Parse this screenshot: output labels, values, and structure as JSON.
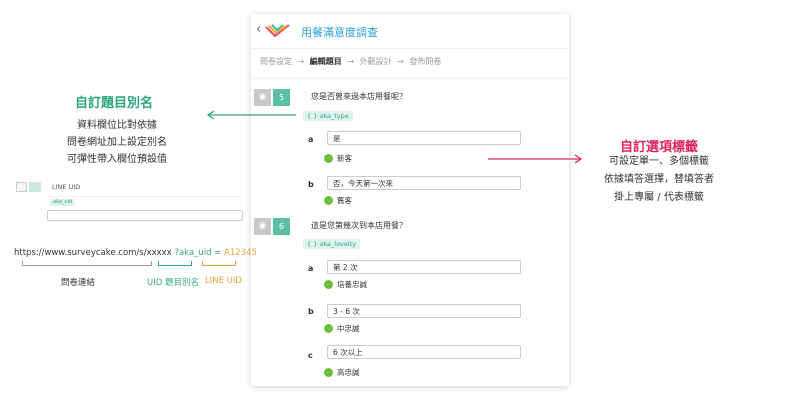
{
  "survey": {
    "title": "用餐滿意度調查"
  },
  "steps": [
    "問卷設定",
    "編輯題目",
    "外觀設計",
    "發佈問卷"
  ],
  "step_arrow": "→",
  "questions": [
    {
      "number": "5",
      "text": "您是否曾來過本店用餐呢？",
      "alias": "{ } aka_type",
      "options": [
        {
          "letter": "a",
          "text": "是",
          "tag": "新客"
        },
        {
          "letter": "b",
          "text": "否，今天第一次來",
          "tag": "舊客"
        }
      ]
    },
    {
      "number": "6",
      "text": "這是您第幾次到本店用餐？",
      "alias": "{ } aka_lovelty",
      "options": [
        {
          "letter": "a",
          "text": "第 2 次",
          "tag": "培養忠誠"
        },
        {
          "letter": "b",
          "text": "3 - 6 次",
          "tag": "中忠誠"
        },
        {
          "letter": "c",
          "text": "6 次以上",
          "tag": "高忠誠"
        }
      ]
    }
  ],
  "left_annotation": {
    "title": "自訂題目別名",
    "lines": [
      "資料欄位比對依據",
      "問卷網址加上設定別名",
      "可彈性帶入欄位預設值"
    ]
  },
  "right_annotation": {
    "title": "自訂選項標籤",
    "lines": [
      "可設定單一、多個標籤",
      "依據填答選擇，替填答者",
      "掛上專屬 / 代表標籤"
    ]
  },
  "mini_field": {
    "label": "LINE UID",
    "alias": "aka_uid"
  },
  "url_example": {
    "base": "https://www.surveycake.com/s/xxxxx",
    "param": "?aka_uid =",
    "value": "A12345"
  },
  "bracket_labels": {
    "base": "問卷連結",
    "param": "UID 題目別名",
    "value": "LINE UID"
  },
  "colors": {
    "teal": "#5bbfa4",
    "green": "#2ea57a",
    "red": "#e0245e",
    "orange": "#e6a23c",
    "blue": "#2a9fd8"
  }
}
